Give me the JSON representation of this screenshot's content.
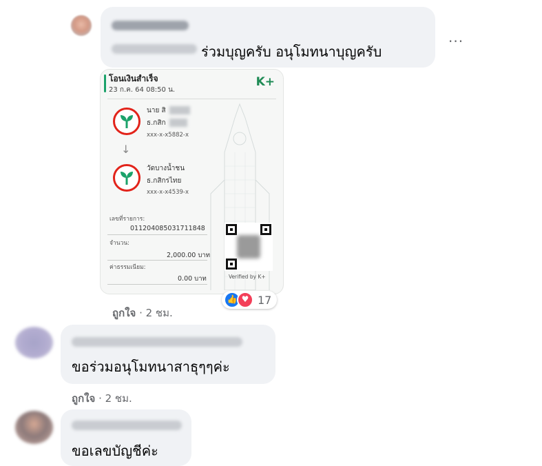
{
  "comments": [
    {
      "text": "ร่วมบุญครับ อนุโมทนาบุญครับ",
      "meta_like": "ถูกใจ",
      "meta_time": "· 2 ชม."
    },
    {
      "text": "ขอร่วมอนุโมทนาสาธุๆๆค่ะ",
      "meta_like": "ถูกใจ",
      "meta_time": "· 2 ชม."
    },
    {
      "text": "ขอเลขบัญชีค่ะ"
    }
  ],
  "more_options": "···",
  "reactions": {
    "count": "17",
    "icons": [
      "like-icon",
      "love-icon"
    ]
  },
  "slip": {
    "title": "โอนเงินสำเร็จ",
    "datetime": "23 ก.ค. 64  08:50 น.",
    "brand": "K+",
    "sender": {
      "name": "นาย สิ",
      "bank": "ธ.กสิก",
      "account": "xxx-x-x5882-x"
    },
    "receiver": {
      "name": "วัดบางน้ำชน",
      "bank": "ธ.กสิกรไทย",
      "account": "xxx-x-x4539-x"
    },
    "ref_label": "เลขที่รายการ:",
    "ref_value": "011204085031711848",
    "amount_label": "จำนวน:",
    "amount_value": "2,000.00 บาท",
    "fee_label": "ค่าธรรมเนียม:",
    "fee_value": "0.00 บาท",
    "verified": "Verified by K+"
  },
  "colors": {
    "bubble": "#f0f2f5",
    "kbank_green": "#1ba26a",
    "kbank_red": "#e2231a",
    "like_blue": "#1877f2",
    "love_red": "#f33e58",
    "meta_gray": "#65676b"
  }
}
